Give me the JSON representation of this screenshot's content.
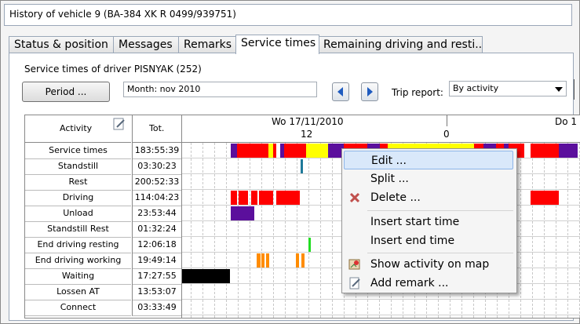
{
  "window": {
    "title": "History of vehicle 9 (BA-384 XK R 0499/939751)"
  },
  "tabs": [
    "Status & position",
    "Messages",
    "Remarks",
    "Service times",
    "Remaining driving and resti..."
  ],
  "active_tab": 3,
  "toolbar": {
    "driver_label": "Service times of driver PISNYAK (252)",
    "period_button": "Period ...",
    "period_value": "Month: nov 2010",
    "trip_report_label": "Trip report:",
    "trip_report_value": "By activity"
  },
  "grid": {
    "col_activity": "Activity",
    "col_total": "Tot.",
    "date_left": "Wo 17/11/2010",
    "date_right": "Do 1",
    "hour_12": "12",
    "hour_0": "0",
    "rows": [
      {
        "name": "Service times",
        "total": "183:55:39"
      },
      {
        "name": "Standstill",
        "total": "03:30:23"
      },
      {
        "name": "Rest",
        "total": "200:52:33"
      },
      {
        "name": "Driving",
        "total": "114:04:23"
      },
      {
        "name": "Unload",
        "total": "23:53:44"
      },
      {
        "name": "Standstill Rest",
        "total": "01:32:24"
      },
      {
        "name": "End driving resting",
        "total": "12:06:18"
      },
      {
        "name": "End driving working",
        "total": "19:49:14"
      },
      {
        "name": "Waiting",
        "total": "17:27:55"
      },
      {
        "name": "Lossen AT",
        "total": "13:53:07"
      },
      {
        "name": "Connect",
        "total": "03:33:49"
      }
    ]
  },
  "context_menu": {
    "items": [
      "Edit ...",
      "Split ...",
      "Delete ...",
      "Insert start time",
      "Insert end time",
      "Show activity on map",
      "Add remark ..."
    ],
    "highlighted": 0
  },
  "colors": {
    "rest": "#ffff00",
    "driving": "#ff0000",
    "unload": "#5b0f9c",
    "standstill": "#1f7a9a",
    "end_resting": "#22dd22",
    "end_working": "#ff8c00",
    "waiting": "#000000",
    "highlight": "#d9e8fa"
  }
}
